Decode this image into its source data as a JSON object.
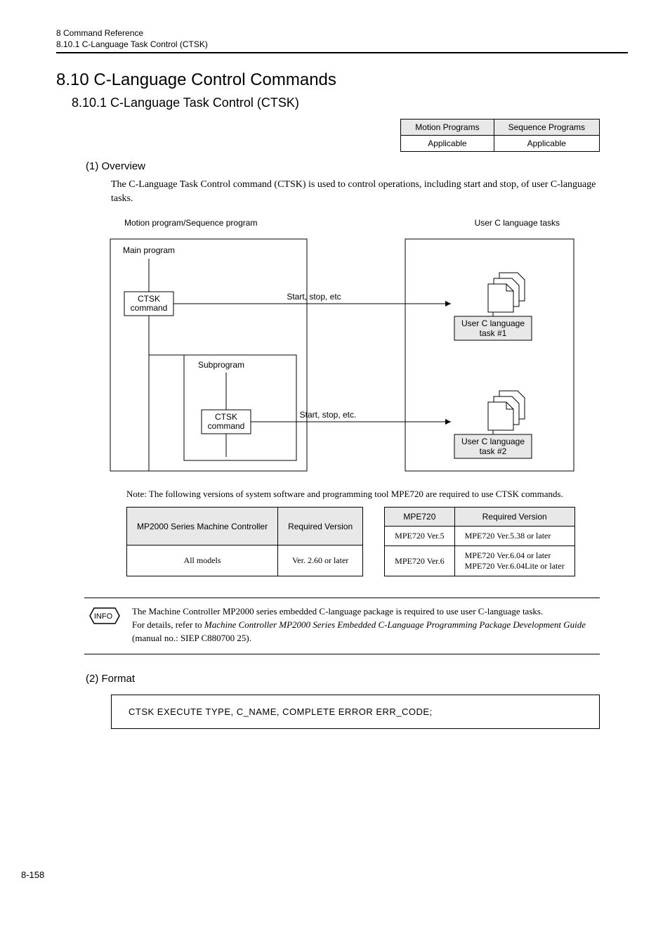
{
  "header": {
    "chapter": "8  Command Reference",
    "section": "8.10.1  C-Language Task Control (CTSK)"
  },
  "h1": "8.10  C-Language Control Commands",
  "h2": "8.10.1  C-Language Task Control (CTSK)",
  "applicability": {
    "col1": "Motion Programs",
    "col2": "Sequence Programs",
    "val1": "Applicable",
    "val2": "Applicable"
  },
  "overview": {
    "heading": "(1) Overview",
    "text": "The C-Language Task Control command (CTSK) is used to control operations, including start and stop, of user C-language tasks."
  },
  "diagram": {
    "left_title": "Motion program/Sequence program",
    "right_title": "User C language tasks",
    "main_program": "Main program",
    "ctsk_command": "CTSK command",
    "subprogram": "Subprogram",
    "start_stop1": "Start, stop, etc",
    "start_stop2": "Start, stop, etc.",
    "task1": "User C language task #1",
    "task2": "User C language task  #2"
  },
  "note": "Note:  The following versions of system software and programming tool MPE720 are required to use CTSK commands.",
  "table1": {
    "h1": "MP2000 Series Machine Controller",
    "h2": "Required Version",
    "r1c1": "All models",
    "r1c2": "Ver. 2.60 or later"
  },
  "table2": {
    "h1": "MPE720",
    "h2": "Required Version",
    "r1c1": "MPE720 Ver.5",
    "r1c2": "MPE720 Ver.5.38 or later",
    "r2c1": "MPE720 Ver.6",
    "r2c2a": "MPE720 Ver.6.04 or later",
    "r2c2b": "MPE720 Ver.6.04Lite or later"
  },
  "info": {
    "badge": "INFO",
    "line1": "The Machine Controller MP2000 series embedded C-language package is required to use user C-language tasks.",
    "line2a": "For details, refer to ",
    "line2b": "Machine Controller MP2000 Series Embedded C-Language Programming Package Development Guide",
    "line2c": " (manual no.: SIEP C880700 25)."
  },
  "format": {
    "heading": "(2) Format",
    "code": "CTSK  EXECUTE  TYPE,  C_NAME,  COMPLETE  ERROR  ERR_CODE;"
  },
  "page_number": "8-158"
}
